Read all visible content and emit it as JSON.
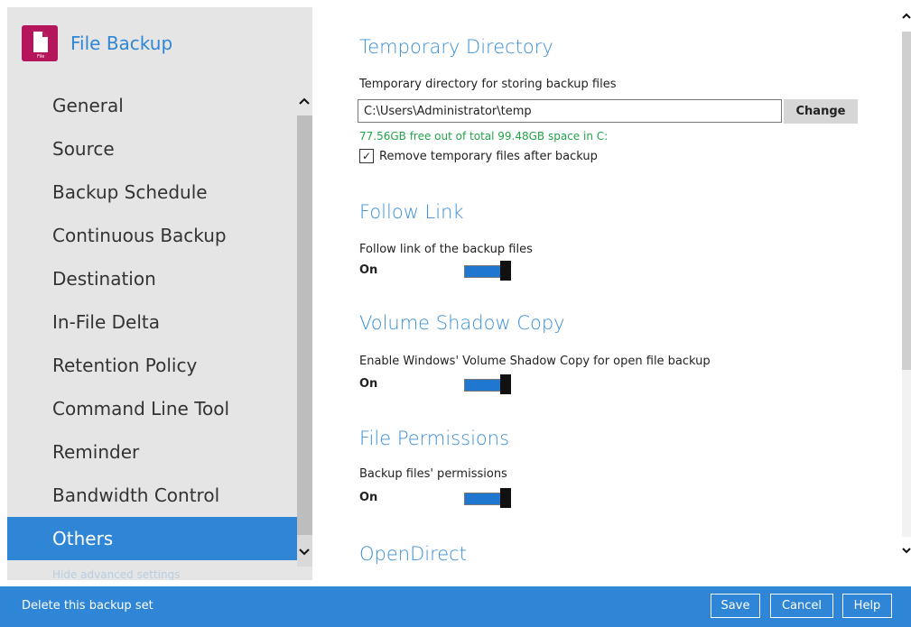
{
  "app": {
    "title": "File Backup",
    "icon_label": "File"
  },
  "sidebar": {
    "items": [
      {
        "label": "General"
      },
      {
        "label": "Source"
      },
      {
        "label": "Backup Schedule"
      },
      {
        "label": "Continuous Backup"
      },
      {
        "label": "Destination"
      },
      {
        "label": "In-File Delta"
      },
      {
        "label": "Retention Policy"
      },
      {
        "label": "Command Line Tool"
      },
      {
        "label": "Reminder"
      },
      {
        "label": "Bandwidth Control"
      },
      {
        "label": "Others",
        "active": true
      }
    ],
    "advanced_link": "Hide advanced settings"
  },
  "temporary_directory": {
    "title": "Temporary Directory",
    "label": "Temporary directory for storing backup files",
    "path": "C:\\Users\\Administrator\\temp",
    "change_label": "Change",
    "free_space": "77.56GB free out of total 99.48GB space in C:",
    "remove_checkbox_label": "Remove temporary files after backup",
    "remove_checked": true
  },
  "follow_link": {
    "title": "Follow Link",
    "label": "Follow link of the backup files",
    "state": "On"
  },
  "volume_shadow_copy": {
    "title": "Volume Shadow Copy",
    "label": "Enable Windows' Volume Shadow Copy for open file backup",
    "state": "On"
  },
  "file_permissions": {
    "title": "File Permissions",
    "label": "Backup files' permissions",
    "state": "On"
  },
  "open_direct": {
    "title": "OpenDirect"
  },
  "footer": {
    "delete_label": "Delete this backup set",
    "save_label": "Save",
    "cancel_label": "Cancel",
    "help_label": "Help"
  },
  "colors": {
    "accent": "#2f86d6",
    "success_text": "#25a34a",
    "app_icon": "#b5155a"
  }
}
